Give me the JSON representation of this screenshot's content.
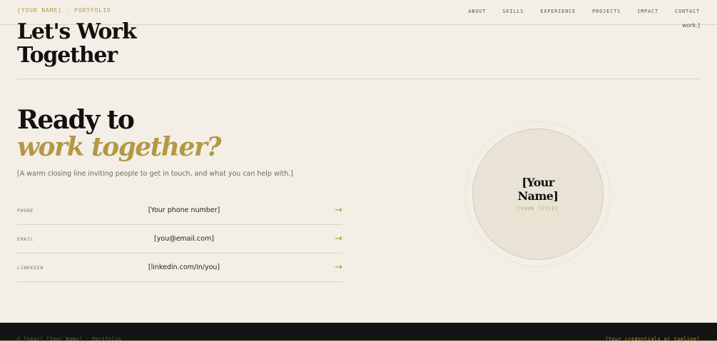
{
  "nav": {
    "brand": "[YOUR NAME] · PORTFOLIO",
    "links": [
      "ABOUT",
      "SKILLS",
      "EXPERIENCE",
      "PROJECTS",
      "IMPACT",
      "CONTACT"
    ]
  },
  "prev_section": {
    "heading_line1": "Let's Work",
    "heading_line2": "Together",
    "side_fragment": "work.]"
  },
  "contact": {
    "heading_line1": "Ready to",
    "heading_line2": "work together?",
    "lead": "[A warm closing line inviting people to get in touch, and what you can help with.]",
    "rows": [
      {
        "label": "PHONE",
        "value": "[Your phone number]",
        "arrow": "→"
      },
      {
        "label": "EMAIL",
        "value": "[you@email.com]",
        "arrow": "→"
      },
      {
        "label": "LINKEDIN",
        "value": "[linkedin.com/in/you]",
        "arrow": "→"
      }
    ]
  },
  "profile": {
    "name_line1": "[Your",
    "name_line2": "Name]",
    "title": "[YOUR TITLE]"
  },
  "footer": {
    "left": "© [Year] [Your Name] · Portfolio",
    "right": "[Your credentials or tagline]"
  },
  "colors": {
    "background": "#f3efe7",
    "accent": "#b39845",
    "footer_bg": "#141414"
  }
}
